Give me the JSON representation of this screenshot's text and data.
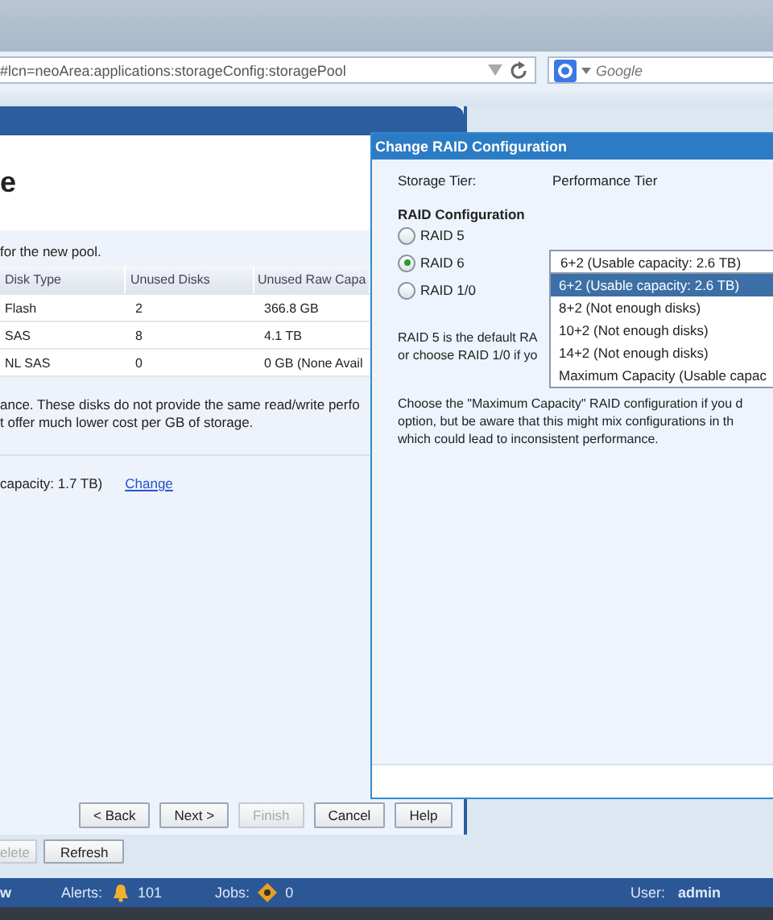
{
  "browser": {
    "url": "#lcn=neoArea:applications:storageConfig:storagePool",
    "search_placeholder": "Google"
  },
  "wizard": {
    "title": "e",
    "instruction": "for the new pool.",
    "table": {
      "columns": [
        "Disk Type",
        "Unused Disks",
        "Unused Raw Capa"
      ],
      "rows": [
        [
          "Flash",
          "2",
          "366.8 GB"
        ],
        [
          "SAS",
          "8",
          "4.1 TB"
        ],
        [
          "NL SAS",
          "0",
          "0 GB (None Avail"
        ]
      ]
    },
    "note_lines": [
      "ance. These disks do not provide the same read/write perfo",
      "t offer much lower cost per GB of storage."
    ],
    "capacity": "capacity: 1.7 TB)",
    "change_link": "Change",
    "buttons": [
      {
        "label": "< Back",
        "disabled": false
      },
      {
        "label": "Next >",
        "disabled": false
      },
      {
        "label": "Finish",
        "disabled": true
      },
      {
        "label": "Cancel",
        "disabled": false
      },
      {
        "label": "Help",
        "disabled": false
      }
    ]
  },
  "toolbar_buttons": [
    {
      "label": "elete",
      "disabled": true
    },
    {
      "label": "Refresh",
      "disabled": false
    }
  ],
  "status_bar": {
    "fragment": "w",
    "alerts_label": "Alerts:",
    "alerts_count": "101",
    "jobs_label": "Jobs:",
    "jobs_count": "0",
    "user_label": "User:",
    "user": "admin"
  },
  "dialog": {
    "title": "Change RAID Configuration",
    "storage_tier_label": "Storage Tier:",
    "storage_tier": "Performance Tier",
    "section_title": "RAID Configuration",
    "options": [
      {
        "label": "RAID 5",
        "selected": false
      },
      {
        "label": "RAID 6",
        "selected": true
      },
      {
        "label": "RAID 1/0",
        "selected": false
      }
    ],
    "dropdown": {
      "value": "6+2 (Usable capacity: 2.6 TB)",
      "items": [
        {
          "label": "6+2 (Usable capacity: 2.6 TB)",
          "selected": true
        },
        {
          "label": "8+2 (Not enough disks)",
          "selected": false
        },
        {
          "label": "10+2 (Not enough disks)",
          "selected": false
        },
        {
          "label": "14+2 (Not enough disks)",
          "selected": false
        },
        {
          "label": "Maximum Capacity (Usable capac",
          "selected": false
        }
      ]
    },
    "paragraph_1": [
      "RAID 5 is the default RA",
      "or choose RAID 1/0 if yo"
    ],
    "paragraph_2": [
      "Choose the \"Maximum Capacity\" RAID configuration if you d",
      "option, but be aware that this might mix configurations in th",
      "which could lead to inconsistent performance."
    ]
  }
}
